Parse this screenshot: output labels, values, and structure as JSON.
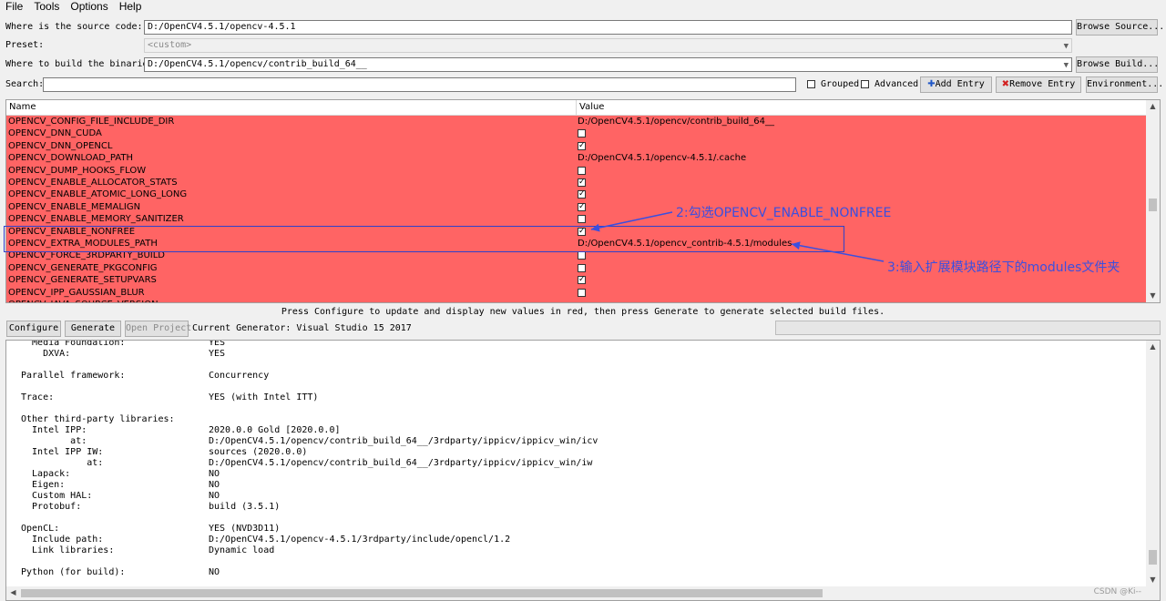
{
  "menu": [
    "File",
    "Tools",
    "Options",
    "Help"
  ],
  "source": {
    "label": "Where is the source code:",
    "value": "D:/OpenCV4.5.1/opencv-4.5.1",
    "button": "Browse Source..."
  },
  "preset": {
    "label": "Preset:",
    "value": "<custom>"
  },
  "build": {
    "label": "Where to build the binaries:",
    "value": "D:/OpenCV4.5.1/opencv/contrib_build_64__",
    "button": "Browse Build..."
  },
  "search": {
    "label": "Search:",
    "value": "",
    "grouped": "Grouped",
    "advanced": "Advanced",
    "add_entry": "Add Entry",
    "remove_entry": "Remove Entry",
    "environment": "Environment..."
  },
  "table": {
    "col_name": "Name",
    "col_value": "Value",
    "rows": [
      {
        "name": "OPENCV_CONFIG_FILE_INCLUDE_DIR",
        "value": "D:/OpenCV4.5.1/opencv/contrib_build_64__"
      },
      {
        "name": "OPENCV_DNN_CUDA",
        "checked": false
      },
      {
        "name": "OPENCV_DNN_OPENCL",
        "checked": true
      },
      {
        "name": "OPENCV_DOWNLOAD_PATH",
        "value": "D:/OpenCV4.5.1/opencv-4.5.1/.cache"
      },
      {
        "name": "OPENCV_DUMP_HOOKS_FLOW",
        "checked": false
      },
      {
        "name": "OPENCV_ENABLE_ALLOCATOR_STATS",
        "checked": true
      },
      {
        "name": "OPENCV_ENABLE_ATOMIC_LONG_LONG",
        "checked": true
      },
      {
        "name": "OPENCV_ENABLE_MEMALIGN",
        "checked": true
      },
      {
        "name": "OPENCV_ENABLE_MEMORY_SANITIZER",
        "checked": false
      },
      {
        "name": "OPENCV_ENABLE_NONFREE",
        "checked": true
      },
      {
        "name": "OPENCV_EXTRA_MODULES_PATH",
        "value": "D:/OpenCV4.5.1/opencv_contrib-4.5.1/modules"
      },
      {
        "name": "OPENCV_FORCE_3RDPARTY_BUILD",
        "checked": false
      },
      {
        "name": "OPENCV_GENERATE_PKGCONFIG",
        "checked": false
      },
      {
        "name": "OPENCV_GENERATE_SETUPVARS",
        "checked": true
      },
      {
        "name": "OPENCV_IPP_GAUSSIAN_BLUR",
        "checked": false
      },
      {
        "name": "OPENCV_JAVA_SOURCE_VERSION",
        "value": ""
      }
    ]
  },
  "annotations": {
    "step2": "2:勾选OPENCV_ENABLE_NONFREE",
    "step3": "3:输入扩展模块路径下的modules文件夹"
  },
  "status_text": "Press Configure to update and display new values in red, then press Generate to generate selected build files.",
  "actions": {
    "configure": "Configure",
    "generate": "Generate",
    "open_project": "Open Project",
    "generator": "Current Generator: Visual Studio 15 2017"
  },
  "output": [
    {
      "k": "  Media Foundation:",
      "v": "YES"
    },
    {
      "k": "    DXVA:",
      "v": "YES"
    },
    {
      "k": "",
      "v": ""
    },
    {
      "k": "Parallel framework:",
      "v": "Concurrency"
    },
    {
      "k": "",
      "v": ""
    },
    {
      "k": "Trace:",
      "v": "YES (with Intel ITT)"
    },
    {
      "k": "",
      "v": ""
    },
    {
      "k": "Other third-party libraries:",
      "v": ""
    },
    {
      "k": "  Intel IPP:",
      "v": "2020.0.0 Gold [2020.0.0]"
    },
    {
      "k": "         at:",
      "v": "D:/OpenCV4.5.1/opencv/contrib_build_64__/3rdparty/ippicv/ippicv_win/icv"
    },
    {
      "k": "  Intel IPP IW:",
      "v": "sources (2020.0.0)"
    },
    {
      "k": "            at:",
      "v": "D:/OpenCV4.5.1/opencv/contrib_build_64__/3rdparty/ippicv/ippicv_win/iw"
    },
    {
      "k": "  Lapack:",
      "v": "NO"
    },
    {
      "k": "  Eigen:",
      "v": "NO"
    },
    {
      "k": "  Custom HAL:",
      "v": "NO"
    },
    {
      "k": "  Protobuf:",
      "v": "build (3.5.1)"
    },
    {
      "k": "",
      "v": ""
    },
    {
      "k": "OpenCL:",
      "v": "YES (NVD3D11)"
    },
    {
      "k": "  Include path:",
      "v": "D:/OpenCV4.5.1/opencv-4.5.1/3rdparty/include/opencl/1.2"
    },
    {
      "k": "  Link libraries:",
      "v": "Dynamic load"
    },
    {
      "k": "",
      "v": ""
    },
    {
      "k": "Python (for build):",
      "v": "NO"
    }
  ],
  "watermark": "CSDN @Ki--",
  "colors": {
    "changed_row": "#ff6464",
    "annotation": "#3a4fe0"
  },
  "icons": [
    "add-icon",
    "remove-icon",
    "chevron-down-icon",
    "scroll-arrow-icon"
  ]
}
